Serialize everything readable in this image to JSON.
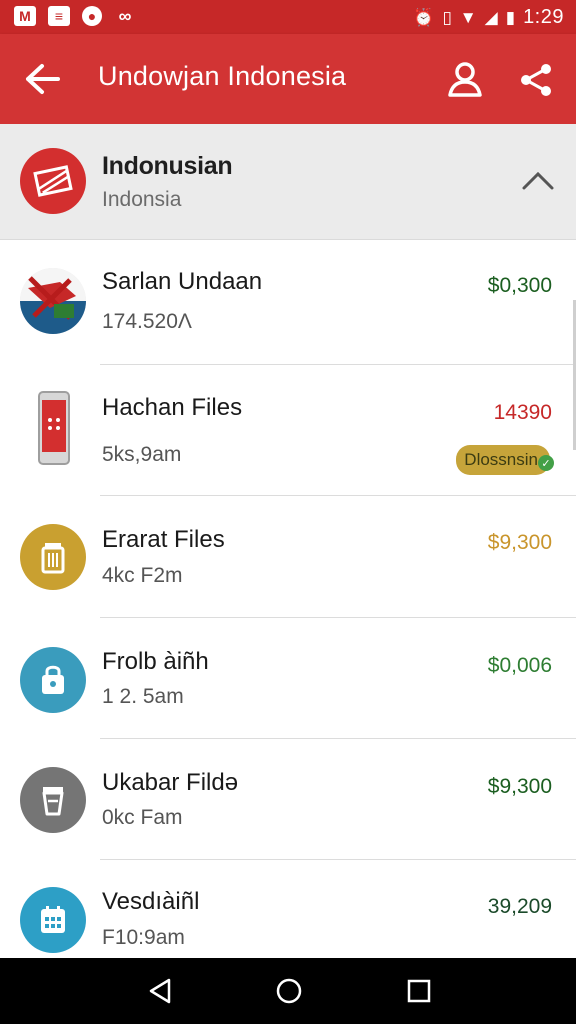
{
  "status_bar": {
    "time": "1:29",
    "left_icons": [
      "gmail-icon",
      "message-icon",
      "record-icon",
      "link-icon"
    ],
    "right_icons": [
      "alarm-icon",
      "vibrate-icon",
      "wifi-icon",
      "signal-icon",
      "battery-icon"
    ]
  },
  "app_bar": {
    "title": "Undowjan Indonesia",
    "color": "#d23434"
  },
  "group": {
    "title": "Indonusian",
    "subtitle": "Indonsia"
  },
  "items": [
    {
      "title": "Sarlan Undaan",
      "subtitle": "174.520Λ",
      "amount": "$0,300",
      "amount_color": "#1b5e20",
      "icon": "flag-photo-icon"
    },
    {
      "title": "Hachan Files",
      "subtitle": "5ks,9am",
      "amount": "14390",
      "amount_color": "#c62828",
      "badge": "Dlossnsin",
      "icon": "phone-icon"
    },
    {
      "title": "Erarat Files",
      "subtitle": "4kc F2m",
      "amount": "$9,300",
      "amount_color": "#c9952c",
      "icon": "trash-icon"
    },
    {
      "title": "Frolb àiñh",
      "subtitle": "1 2. 5am",
      "amount": "$0,006",
      "amount_color": "#2e7d32",
      "icon": "bag-icon"
    },
    {
      "title": "Ukabar Fildə",
      "subtitle": "0kc Fam",
      "amount": "$9,300",
      "amount_color": "#1b5e20",
      "icon": "cup-icon"
    },
    {
      "title": "Vesdıàiñl",
      "subtitle": "F10:9am",
      "amount": "39,209",
      "amount_color": "#1b4a2a",
      "icon": "calendar-icon"
    }
  ]
}
